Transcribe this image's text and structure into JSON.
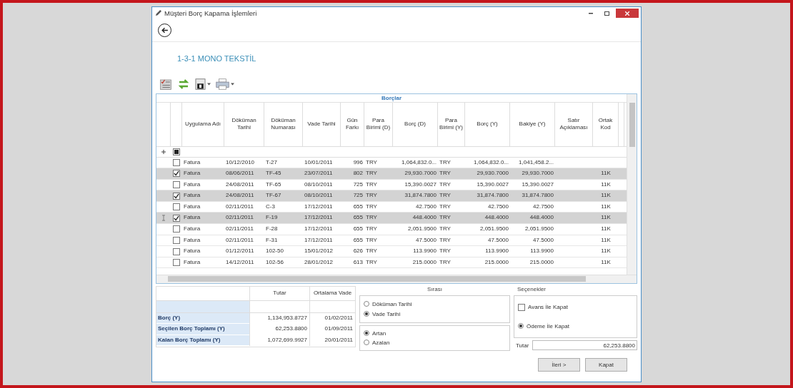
{
  "window": {
    "title": "Müşteri Borç Kapama İşlemleri"
  },
  "company": "1-3-1 MONO TEKSTİL",
  "grid": {
    "title": "Borçlar",
    "select_all": {
      "indeterminate": true
    },
    "columns": [
      {
        "label": "Uygulama Adı",
        "kind": "text"
      },
      {
        "label": "Döküman Tarihi",
        "kind": "text"
      },
      {
        "label": "Döküman Numarası",
        "kind": "text"
      },
      {
        "label": "Vade Tarihi",
        "kind": "text"
      },
      {
        "label": "Gün Farkı",
        "kind": "number"
      },
      {
        "label": "Para Birimi (D)",
        "kind": "text"
      },
      {
        "label": "Borç (D)",
        "kind": "number"
      },
      {
        "label": "Para Birimi (Y)",
        "kind": "text"
      },
      {
        "label": "Borç (Y)",
        "kind": "number"
      },
      {
        "label": "Bakiye (Y)",
        "kind": "number"
      },
      {
        "label": "Satır Açıklaması",
        "kind": "text"
      },
      {
        "label": "Ortak Kod",
        "kind": "code"
      }
    ],
    "rows": [
      {
        "checked": false,
        "current": false,
        "cells": [
          "Fatura",
          "10/12/2010",
          "T-27",
          "10/01/2011",
          "996",
          "TRY",
          "1,064,832.0...",
          "TRY",
          "1,064,832.0...",
          "1,041,458.2...",
          null,
          null
        ]
      },
      {
        "checked": true,
        "current": false,
        "cells": [
          "Fatura",
          "08/06/2011",
          "TF-45",
          "23/07/2011",
          "802",
          "TRY",
          "29,930.7000",
          "TRY",
          "29,930.7000",
          "29,930.7000",
          null,
          "11K"
        ]
      },
      {
        "checked": false,
        "current": false,
        "cells": [
          "Fatura",
          "24/08/2011",
          "TF-65",
          "08/10/2011",
          "725",
          "TRY",
          "15,390.0027",
          "TRY",
          "15,390.0027",
          "15,390.0027",
          null,
          "11K"
        ]
      },
      {
        "checked": true,
        "current": false,
        "cells": [
          "Fatura",
          "24/08/2011",
          "TF-67",
          "08/10/2011",
          "725",
          "TRY",
          "31,874.7800",
          "TRY",
          "31,874.7800",
          "31,874.7800",
          null,
          "11K"
        ]
      },
      {
        "checked": false,
        "current": false,
        "cells": [
          "Fatura",
          "02/11/2011",
          "C-3",
          "17/12/2011",
          "655",
          "TRY",
          "42.7500",
          "TRY",
          "42.7500",
          "42.7500",
          null,
          "11K"
        ]
      },
      {
        "checked": true,
        "current": true,
        "cells": [
          "Fatura",
          "02/11/2011",
          "F-19",
          "17/12/2011",
          "655",
          "TRY",
          "448.4000",
          "TRY",
          "448.4000",
          "448.4000",
          null,
          "11K"
        ]
      },
      {
        "checked": false,
        "current": false,
        "cells": [
          "Fatura",
          "02/11/2011",
          "F-28",
          "17/12/2011",
          "655",
          "TRY",
          "2,051.9500",
          "TRY",
          "2,051.9500",
          "2,051.9500",
          null,
          "11K"
        ]
      },
      {
        "checked": false,
        "current": false,
        "cells": [
          "Fatura",
          "02/11/2011",
          "F-31",
          "17/12/2011",
          "655",
          "TRY",
          "47.5000",
          "TRY",
          "47.5000",
          "47.5000",
          null,
          "11K"
        ]
      },
      {
        "checked": false,
        "current": false,
        "cells": [
          "Fatura",
          "01/12/2011",
          "102-50",
          "15/01/2012",
          "626",
          "TRY",
          "113.9900",
          "TRY",
          "113.9900",
          "113.9900",
          null,
          "11K"
        ]
      },
      {
        "checked": false,
        "current": false,
        "cells": [
          "Fatura",
          "14/12/2011",
          "102-56",
          "28/01/2012",
          "613",
          "TRY",
          "215.0000",
          "TRY",
          "215.0000",
          "215.0000",
          null,
          "11K"
        ]
      }
    ]
  },
  "summary": {
    "columns": [
      "Tutar",
      "Ortalama Vade"
    ],
    "rows": [
      {
        "label": "Borç (Y)",
        "amount": "1,134,953.8727",
        "due": "01/02/2011"
      },
      {
        "label": "Seçilen Borç Toplamı (Y)",
        "amount": "62,253.8800",
        "due": "01/09/2011"
      },
      {
        "label": "Kalan Borç Toplamı (Y)",
        "amount": "1,072,699.9927",
        "due": "20/01/2011"
      }
    ]
  },
  "sort": {
    "title": "Sırası",
    "fields": [
      {
        "label": "Döküman Tarihi",
        "selected": false
      },
      {
        "label": "Vade Tarihi",
        "selected": true
      }
    ],
    "order": [
      {
        "label": "Artan",
        "selected": true
      },
      {
        "label": "Azalan",
        "selected": false
      }
    ]
  },
  "options": {
    "title": "Seçenekler",
    "advance": {
      "label": "Avans İle Kapat",
      "checked": false
    },
    "payment": {
      "label": "Ödeme İle Kapat",
      "selected": true
    },
    "amount_label": "Tutar",
    "amount": "62,253.8800"
  },
  "buttons": [
    {
      "label": "İleri >"
    },
    {
      "label": "Kapat"
    }
  ]
}
